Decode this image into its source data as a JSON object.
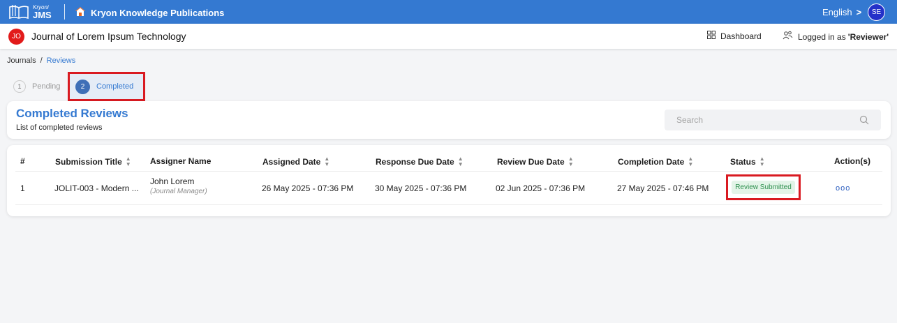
{
  "header": {
    "logo_small": "Kryoni",
    "logo_big": "JMS",
    "publisher": "Kryon Knowledge Publications",
    "language": "English",
    "language_chevron": ">",
    "user_initials": "SE"
  },
  "journal": {
    "badge": "JO",
    "title": "Journal of Lorem Ipsum Technology",
    "dashboard_label": "Dashboard",
    "logged_in_prefix": "Logged in as",
    "logged_in_role": "'Reviewer'"
  },
  "breadcrumb": {
    "root": "Journals",
    "separator": "/",
    "current": "Reviews"
  },
  "tabs": [
    {
      "number": "1",
      "label": "Pending"
    },
    {
      "number": "2",
      "label": "Completed"
    }
  ],
  "section": {
    "title": "Completed Reviews",
    "subtitle": "List of completed reviews",
    "search_placeholder": "Search"
  },
  "table": {
    "columns": [
      "#",
      "Submission Title",
      "Assigner Name",
      "Assigned Date",
      "Response Due Date",
      "Review Due Date",
      "Completion Date",
      "Status",
      "Action(s)"
    ],
    "rows": [
      {
        "index": "1",
        "submission_title": "JOLIT-003 - Modern ...",
        "assigner_name": "John Lorem",
        "assigner_role": "(Journal Manager)",
        "assigned_date": "26 May 2025 - 07:36 PM",
        "response_due_date": "30 May 2025 - 07:36 PM",
        "review_due_date": "02 Jun 2025 - 07:36 PM",
        "completion_date": "27 May 2025 - 07:46 PM",
        "status": "Review Submitted",
        "action": "ooo"
      }
    ]
  },
  "icons": {
    "logo": "open-book-icon",
    "publisher": "home-icon",
    "dashboard": "grid-icon",
    "user": "users-icon",
    "search": "search-icon",
    "sort": "sort-icon"
  },
  "colors": {
    "topbar": "#3479d1",
    "accent": "#3479d1",
    "highlight_border": "#d91a21",
    "status_bg": "#e3f4e8",
    "status_text": "#2d8f4e",
    "journal_badge": "#e21a1a",
    "avatar": "#2431c9"
  }
}
